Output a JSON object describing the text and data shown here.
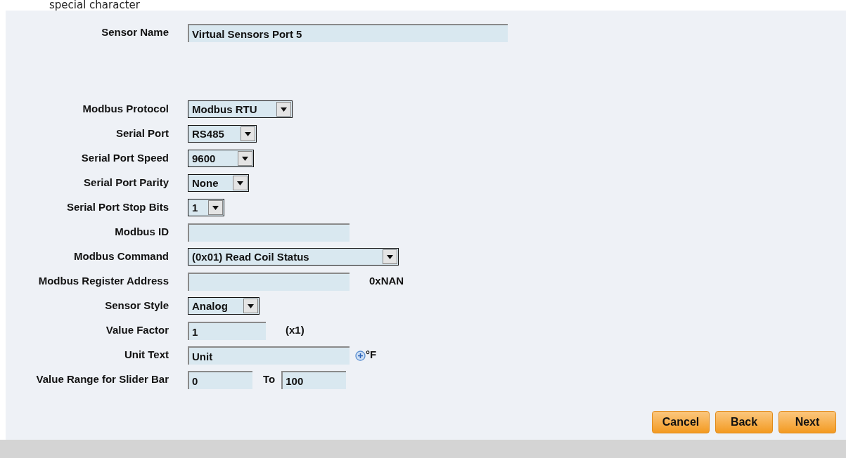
{
  "note": "special character",
  "sensor_name": {
    "label": "Sensor Name",
    "value": "Virtual Sensors Port 5"
  },
  "fields": [
    {
      "kind": "select",
      "label": "Modbus Protocol",
      "value": "Modbus RTU"
    },
    {
      "kind": "select",
      "label": "Serial Port",
      "value": "RS485"
    },
    {
      "kind": "select",
      "label": "Serial Port Speed",
      "value": "9600"
    },
    {
      "kind": "select",
      "label": "Serial Port Parity",
      "value": "None"
    },
    {
      "kind": "select",
      "label": "Serial Port Stop Bits",
      "value": "1"
    },
    {
      "kind": "input",
      "label": "Modbus ID"
    },
    {
      "kind": "select",
      "label": "Modbus Command",
      "value": "(0x01) Read Coil Status"
    },
    {
      "kind": "input",
      "label": "Modbus Register Address",
      "suffix": "0xNAN"
    },
    {
      "kind": "select",
      "label": "Sensor Style",
      "value": "Analog"
    },
    {
      "kind": "input",
      "label": "Value Factor",
      "value": "1",
      "suffix": "(x1)"
    },
    {
      "kind": "unit",
      "label": "Unit Text",
      "value": "Unit",
      "symbol": "°F"
    },
    {
      "kind": "range",
      "label": "Value Range for Slider Bar",
      "from": "0",
      "to_label": "To",
      "to": "100"
    }
  ],
  "buttons": [
    "Cancel",
    "Back",
    "Next"
  ]
}
